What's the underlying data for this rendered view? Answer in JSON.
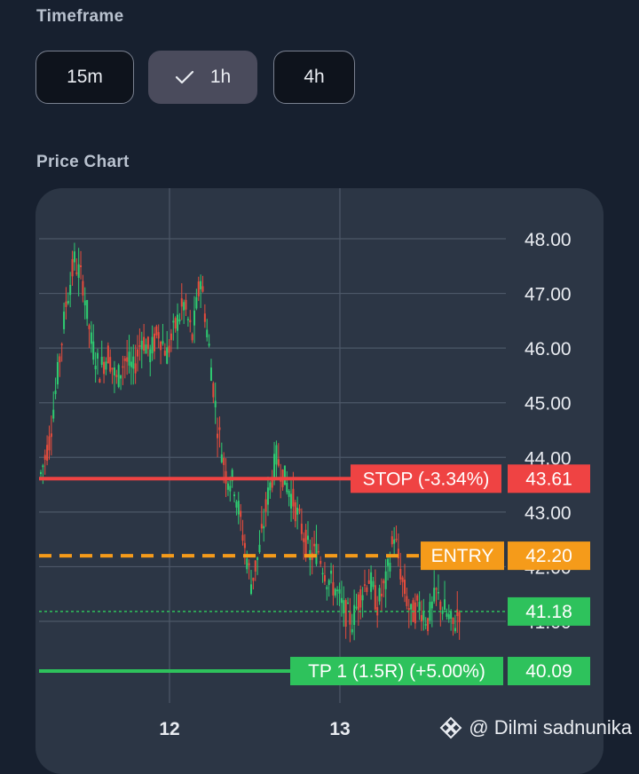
{
  "timeframe": {
    "title": "Timeframe",
    "options": [
      {
        "label": "15m",
        "selected": false
      },
      {
        "label": "1h",
        "selected": true
      },
      {
        "label": "4h",
        "selected": false
      }
    ]
  },
  "price_chart": {
    "title": "Price Chart"
  },
  "chart_data": {
    "type": "candlestick",
    "y_ticks": [
      "48.00",
      "47.00",
      "46.00",
      "45.00",
      "44.00",
      "43.00",
      "42.00",
      "41.00"
    ],
    "x_ticks": [
      "12",
      "13"
    ],
    "ylim": [
      39.2,
      48.6
    ],
    "grid": true,
    "colors": {
      "up": "#2ecc71",
      "down": "#e74c3c",
      "stop": "#ef4343",
      "entry": "#f59b1a",
      "tp": "#2ec25c",
      "current": "#2ec25c"
    },
    "levels": {
      "stop": {
        "label": "STOP (-3.34%)",
        "value": "43.61",
        "price": 43.61
      },
      "entry": {
        "label": "ENTRY",
        "value": "42.20",
        "price": 42.2
      },
      "current": {
        "value": "41.18",
        "price": 41.18
      },
      "tp": {
        "label": "TP 1 (1.5R) (+5.00%)",
        "value": "40.09",
        "price": 40.09
      }
    },
    "series": [
      43.7,
      44.3,
      45.5,
      46.8,
      47.6,
      47.2,
      46.1,
      45.6,
      45.9,
      45.4,
      45.8,
      45.6,
      46.2,
      45.9,
      46.3,
      45.9,
      46.4,
      46.8,
      46.2,
      47.3,
      46.0,
      44.6,
      43.7,
      43.5,
      42.6,
      41.7,
      42.3,
      43.3,
      44.0,
      43.6,
      43.2,
      42.7,
      42.2,
      42.3,
      41.8,
      41.6,
      41.2,
      41.0,
      41.5,
      41.8,
      41.3,
      41.7,
      42.6,
      41.7,
      41.1,
      41.3,
      41.0,
      41.5,
      41.2,
      40.9,
      41.3
    ]
  },
  "watermark": {
    "text": "@ Dilmi sadnunika"
  }
}
